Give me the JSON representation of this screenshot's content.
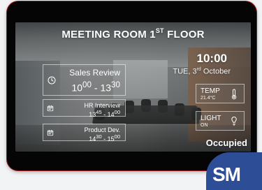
{
  "title": {
    "main": "MEETING ROOM 1",
    "sup": "ST",
    "rest": " FLOOR"
  },
  "clock": {
    "time": "10:00",
    "day": "TUE, 3",
    "day_sup": "rd",
    "month": " October"
  },
  "meetings": [
    {
      "name": "Sales Review",
      "start_h": "10",
      "start_m": "00",
      "sep": " - ",
      "end_h": "13",
      "end_m": "30",
      "icon": "clock-icon"
    },
    {
      "name": "HR Interview",
      "start_h": "13",
      "start_m": "45",
      "sep": " - ",
      "end_h": "14",
      "end_m": "00",
      "icon": "calendar-icon"
    },
    {
      "name": "Product Dev.",
      "start_h": "14",
      "start_m": "30",
      "sep": " - ",
      "end_h": "15",
      "end_m": "00",
      "icon": "calendar-icon"
    }
  ],
  "sensors": {
    "temp": {
      "label": "TEMP",
      "value": "21.4°C",
      "icon": "thermometer-icon"
    },
    "light": {
      "label": "LIGHT",
      "value": "ON",
      "icon": "bulb-icon"
    }
  },
  "status": {
    "text": "Occupied"
  },
  "brand": {
    "text": "SM"
  },
  "colors": {
    "bezel_accent": "#9f1a1a",
    "brand_blue": "#2d4d96"
  }
}
